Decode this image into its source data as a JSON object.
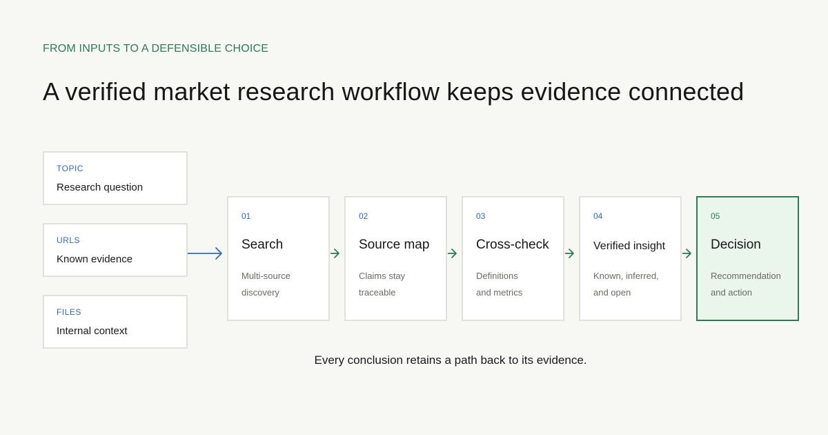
{
  "header": {
    "eyebrow": "FROM INPUTS TO A DEFENSIBLE CHOICE",
    "title": "A verified market research workflow keeps evidence connected"
  },
  "inputs": [
    {
      "kicker": "TOPIC",
      "label": "Research question"
    },
    {
      "kicker": "URLS",
      "label": "Known evidence"
    },
    {
      "kicker": "FILES",
      "label": "Internal context"
    }
  ],
  "steps": [
    {
      "num": "01",
      "name": "Search",
      "desc": [
        "Multi-source",
        "discovery"
      ]
    },
    {
      "num": "02",
      "name": "Source map",
      "desc": [
        "Claims stay",
        "traceable"
      ]
    },
    {
      "num": "03",
      "name": "Cross-check",
      "desc": [
        "Definitions",
        "and metrics"
      ]
    },
    {
      "num": "04",
      "name": "Verified insight",
      "desc": [
        "Known, inferred,",
        "and open"
      ]
    },
    {
      "num": "05",
      "name": "Decision",
      "desc": [
        "Recommendation",
        "and action"
      ]
    }
  ],
  "footer": "Every conclusion retains a path back to its evidence.",
  "colors": {
    "background": "#f7f7f3",
    "accent_green": "#2e7a55",
    "accent_blue": "#3567b6",
    "decision_fill": "#eaf5ec"
  },
  "icons": {
    "input_arrow": "arrow-right-icon",
    "step_arrow": "arrow-right-icon"
  }
}
